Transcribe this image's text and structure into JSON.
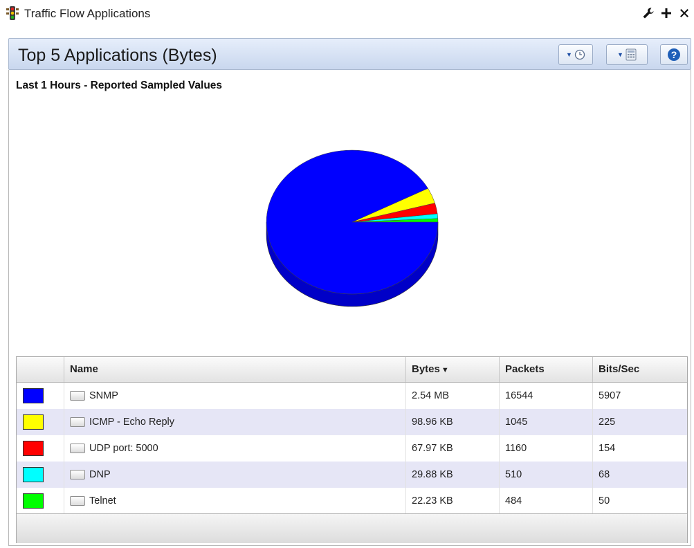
{
  "window": {
    "title": "Traffic Flow Applications",
    "icon": "traffic-light-icon",
    "controls": [
      {
        "name": "wrench-icon",
        "glyph": "🔧"
      },
      {
        "name": "add-icon",
        "glyph": "+"
      },
      {
        "name": "close-icon",
        "glyph": "×"
      }
    ]
  },
  "panel": {
    "title": "Top 5 Applications (Bytes)",
    "buttons": [
      "time-range-icon",
      "calculator-icon",
      "help-icon"
    ]
  },
  "chart": {
    "subtitle": "Last 1 Hours - Reported Sampled Values"
  },
  "chart_data": {
    "type": "pie",
    "categories": [
      "SNMP",
      "ICMP - Echo Reply",
      "UDP port: 5000",
      "DNP",
      "Telnet"
    ],
    "values": [
      2.54,
      0.09664,
      0.06638,
      0.02918,
      0.02171
    ],
    "unit": "MB",
    "colors": [
      "#0000ff",
      "#ffff00",
      "#ff0000",
      "#00ffff",
      "#00ff00"
    ]
  },
  "table": {
    "headers": {
      "name": "Name",
      "bytes": "Bytes",
      "packets": "Packets",
      "bits": "Bits/Sec"
    },
    "sort_indicator": "▼",
    "rows": [
      {
        "color": "#0000ff",
        "name": "SNMP",
        "bytes": "2.54 MB",
        "packets": "16544",
        "bits": "5907"
      },
      {
        "color": "#ffff00",
        "name": "ICMP - Echo Reply",
        "bytes": "98.96 KB",
        "packets": "1045",
        "bits": "225"
      },
      {
        "color": "#ff0000",
        "name": "UDP port: 5000",
        "bytes": "67.97 KB",
        "packets": "1160",
        "bits": "154"
      },
      {
        "color": "#00ffff",
        "name": "DNP",
        "bytes": "29.88 KB",
        "packets": "510",
        "bits": "68"
      },
      {
        "color": "#00ff00",
        "name": "Telnet",
        "bytes": "22.23 KB",
        "packets": "484",
        "bits": "50"
      }
    ]
  }
}
